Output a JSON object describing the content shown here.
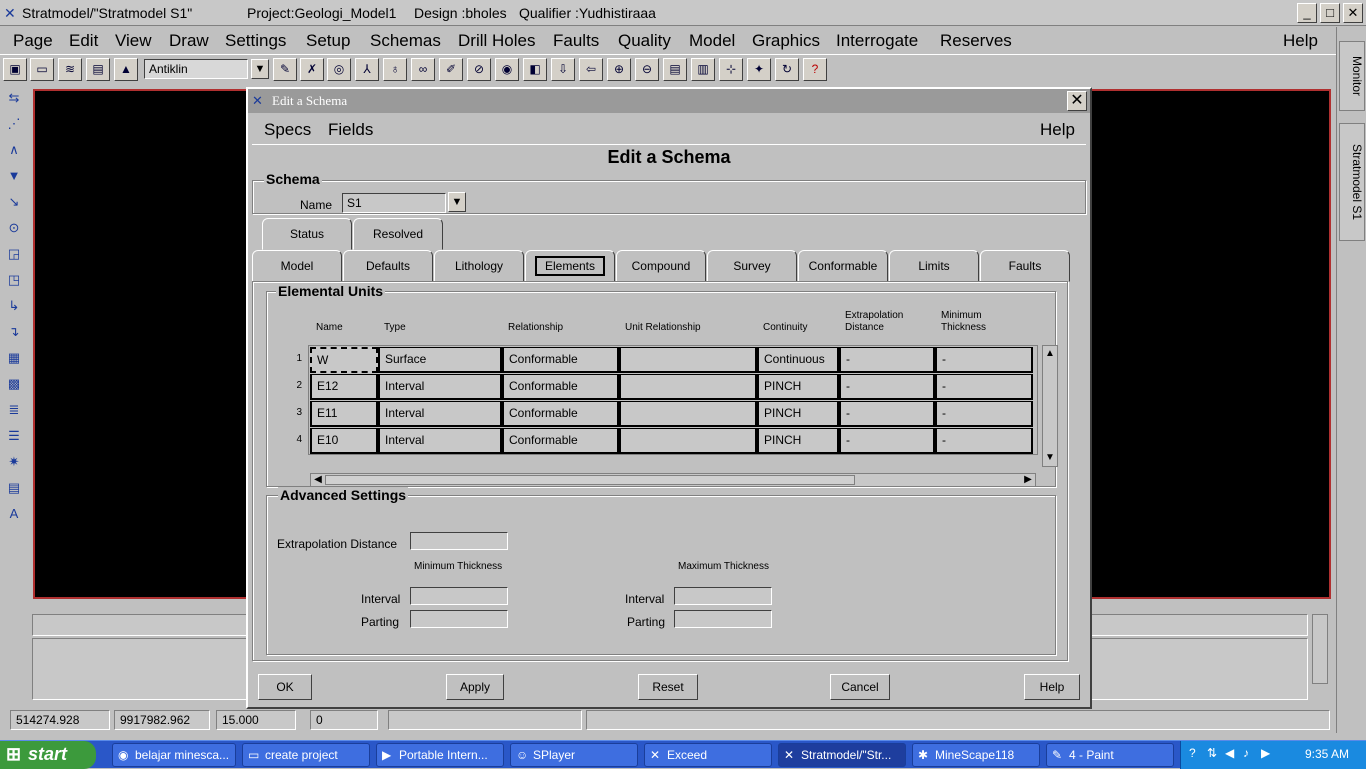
{
  "window": {
    "title": "Stratmodel/\"Stratmodel S1\"",
    "project": "Project:Geologi_Model1",
    "design": "Design :bholes",
    "qualifier": "Qualifier :Yudhistiraaa",
    "btn_min": "_",
    "btn_max": "□",
    "btn_close": "✕"
  },
  "menu": {
    "items": [
      "Page",
      "Edit",
      "View",
      "Draw",
      "Settings",
      "Setup",
      "Schemas",
      "Drill Holes",
      "Faults",
      "Quality",
      "Model",
      "Graphics",
      "Interrogate",
      "Reserves"
    ],
    "help": "Help"
  },
  "toolbar": {
    "layer_value": "Antiklin",
    "dropdown_glyph": "▼",
    "icons": [
      "▣",
      "▭",
      "≋",
      "▤",
      "▲",
      "✎",
      "✗",
      "◎",
      "⅄",
      "♁",
      "∞",
      "✐",
      "⊘",
      "◉",
      "◧",
      "⇩",
      "⇦",
      "⊕",
      "⊖",
      "▤",
      "▥",
      "⊹",
      "✦",
      "↻",
      "?"
    ]
  },
  "lefttools": [
    "⇆",
    "⋰",
    "∧",
    "▼",
    "↘",
    "⊙",
    "◲",
    "◳",
    "↳",
    "↴",
    "▦",
    "▩",
    "≣",
    "☰",
    "✷",
    "▤",
    "A"
  ],
  "sidepanel": {
    "monitor": "Monitor",
    "stratmodel": "Stratmodel S1"
  },
  "status": {
    "x": "514274.928",
    "y": "9917982.962",
    "z": "15.000",
    "v4": "0",
    "v5": ""
  },
  "dialog": {
    "title": "Edit a Schema",
    "close": "✕",
    "menu_specs": "Specs",
    "menu_fields": "Fields",
    "menu_help": "Help",
    "heading": "Edit a Schema",
    "schema_group": "Schema",
    "name_label": "Name",
    "name_value": "S1",
    "dropdown_glyph": "▼",
    "tabs_row1": [
      "Status",
      "Resolved"
    ],
    "tabs_row2": [
      "Model",
      "Defaults",
      "Lithology",
      "Elements",
      "Compound",
      "Survey",
      "Conformable",
      "Limits",
      "Faults"
    ],
    "selected_tab": "Elements",
    "elemental_group": "Elemental Units",
    "columns": {
      "name": "Name",
      "type": "Type",
      "relationship": "Relationship",
      "unit_relationship": "Unit Relationship",
      "continuity": "Continuity",
      "extrap_1": "Extrapolation",
      "extrap_2": "Distance",
      "minthk_1": "Minimum",
      "minthk_2": "Thickness"
    },
    "rows": [
      {
        "num": "1",
        "name": "W",
        "type": "Surface",
        "relationship": "Conformable",
        "unit_relationship": "",
        "continuity": "Continuous",
        "extrap": "-",
        "minthk": "-"
      },
      {
        "num": "2",
        "name": "E12",
        "type": "Interval",
        "relationship": "Conformable",
        "unit_relationship": "",
        "continuity": "PINCH",
        "extrap": "-",
        "minthk": "-"
      },
      {
        "num": "3",
        "name": "E11",
        "type": "Interval",
        "relationship": "Conformable",
        "unit_relationship": "",
        "continuity": "PINCH",
        "extrap": "-",
        "minthk": "-"
      },
      {
        "num": "4",
        "name": "E10",
        "type": "Interval",
        "relationship": "Conformable",
        "unit_relationship": "",
        "continuity": "PINCH",
        "extrap": "-",
        "minthk": "-"
      }
    ],
    "advanced_group": "Advanced Settings",
    "extrap_label": "Extrapolation Distance",
    "min_thickness": "Minimum Thickness",
    "max_thickness": "Maximum Thickness",
    "interval_label": "Interval",
    "parting_label": "Parting",
    "buttons": {
      "ok": "OK",
      "apply": "Apply",
      "reset": "Reset",
      "cancel": "Cancel",
      "help": "Help"
    }
  },
  "taskbar": {
    "start": "start",
    "tasks": [
      {
        "label": "belajar minesca..."
      },
      {
        "label": "create project"
      },
      {
        "label": "Portable Intern..."
      },
      {
        "label": "SPlayer"
      },
      {
        "label": "Exceed"
      },
      {
        "label": "Stratmodel/\"Str..."
      },
      {
        "label": "MineScape118"
      },
      {
        "label": "4 - Paint"
      }
    ],
    "time": "9:35 AM"
  }
}
